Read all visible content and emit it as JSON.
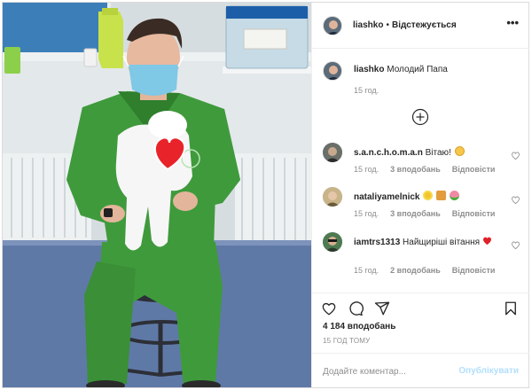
{
  "post": {
    "author": "liashko",
    "separator": "•",
    "follow_label": "Відстежується",
    "more_label": "•••",
    "caption_author": "liashko",
    "caption_text": "Молодий Папа",
    "caption_time": "15 год.",
    "likes": "4 184 вподобань",
    "time_ago": "15 ГОД ТОМУ",
    "comment_placeholder": "Додайте коментар...",
    "publish_label": "Опублікувати"
  },
  "comments": [
    {
      "author": "s.a.n.c.h.o.m.a.n",
      "text": "Вітаю!",
      "emojis": [
        "smile"
      ],
      "time": "15 год.",
      "likes": "3 вподобань",
      "reply": "Відповісти"
    },
    {
      "author": "nataliyamelnick",
      "text": "",
      "emojis": [
        "sunflower",
        "couple",
        "bouquet"
      ],
      "time": "15 год.",
      "likes": "3 вподобань",
      "reply": "Відповісти"
    },
    {
      "author": "iamtrs1313",
      "text": "Найщиріші вітання",
      "emojis": [
        "red-heart"
      ],
      "time": "15 год.",
      "likes": "2 вподобань",
      "reply": "Відповісти"
    }
  ],
  "colors": {
    "scrubs": "#3f9a3c",
    "link": "#00376b",
    "publish_disabled": "#b2dffc",
    "muted": "#8e8e8e",
    "border": "#dbdbdb",
    "heart": "#ed4956"
  },
  "icons": [
    "more-icon",
    "add-circle-icon",
    "heart-icon",
    "comment-icon",
    "share-icon",
    "bookmark-icon"
  ]
}
